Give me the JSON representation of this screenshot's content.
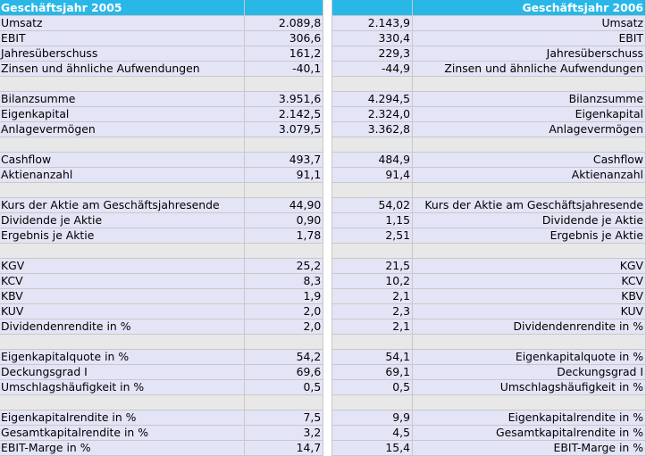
{
  "header": {
    "left_title": "Geschäftsjahr 2005",
    "right_title": "Geschäftsjahr 2006"
  },
  "groups": [
    {
      "rows": [
        {
          "label": "Umsatz",
          "v2005": "2.089,8",
          "v2006": "2.143,9"
        },
        {
          "label": "EBIT",
          "v2005": "306,6",
          "v2006": "330,4"
        },
        {
          "label": "Jahresüberschuss",
          "v2005": "161,2",
          "v2006": "229,3"
        },
        {
          "label": "Zinsen und ähnliche Aufwendungen",
          "v2005": "-40,1",
          "v2006": "-44,9"
        }
      ]
    },
    {
      "rows": [
        {
          "label": "Bilanzsumme",
          "v2005": "3.951,6",
          "v2006": "4.294,5"
        },
        {
          "label": "Eigenkapital",
          "v2005": "2.142,5",
          "v2006": "2.324,0"
        },
        {
          "label": "Anlagevermögen",
          "v2005": "3.079,5",
          "v2006": "3.362,8"
        }
      ]
    },
    {
      "rows": [
        {
          "label": "Cashflow",
          "v2005": "493,7",
          "v2006": "484,9"
        },
        {
          "label": "Aktienanzahl",
          "v2005": "91,1",
          "v2006": "91,4"
        }
      ]
    },
    {
      "rows": [
        {
          "label": "Kurs der Aktie am Geschäftsjahresende",
          "v2005": "44,90",
          "v2006": "54,02"
        },
        {
          "label": "Dividende je Aktie",
          "v2005": "0,90",
          "v2006": "1,15"
        },
        {
          "label": "Ergebnis je Aktie",
          "v2005": "1,78",
          "v2006": "2,51"
        }
      ]
    },
    {
      "rows": [
        {
          "label": "KGV",
          "v2005": "25,2",
          "v2006": "21,5"
        },
        {
          "label": "KCV",
          "v2005": "8,3",
          "v2006": "10,2"
        },
        {
          "label": "KBV",
          "v2005": "1,9",
          "v2006": "2,1"
        },
        {
          "label": "KUV",
          "v2005": "2,0",
          "v2006": "2,3"
        },
        {
          "label": "Dividendenrendite in %",
          "v2005": "2,0",
          "v2006": "2,1"
        }
      ]
    },
    {
      "rows": [
        {
          "label": "Eigenkapitalquote in %",
          "v2005": "54,2",
          "v2006": "54,1"
        },
        {
          "label": "Deckungsgrad I",
          "v2005": "69,6",
          "v2006": "69,1"
        },
        {
          "label": "Umschlagshäufigkeit in %",
          "v2005": "0,5",
          "v2006": "0,5"
        }
      ]
    },
    {
      "rows": [
        {
          "label": "Eigenkapitalrendite in %",
          "v2005": "7,5",
          "v2006": "9,9"
        },
        {
          "label": "Gesamtkapitalrendite in %",
          "v2005": "3,2",
          "v2006": "4,5"
        },
        {
          "label": "EBIT-Marge in %",
          "v2005": "14,7",
          "v2006": "15,4"
        }
      ]
    }
  ]
}
